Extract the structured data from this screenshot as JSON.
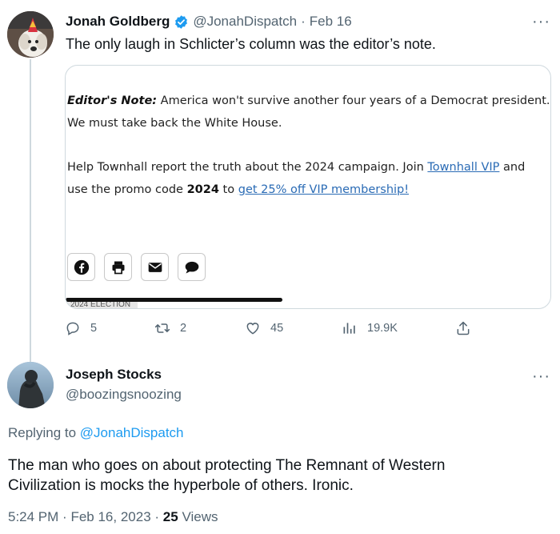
{
  "tweet1": {
    "author_name": "Jonah Goldberg",
    "handle": "@JonahDispatch",
    "separator": "·",
    "date": "Feb 16",
    "more": "···",
    "text": "The only laugh in Schlicter’s column was the editor’s note.",
    "card": {
      "note_label": "Editor's Note:",
      "note_line1": " America won't survive another four years of a Democrat president.",
      "note_line2": "We must take back the White House.",
      "help_pre": "Help Townhall report the truth about the 2024 campaign. Join ",
      "help_link1": "Townhall VIP",
      "help_mid": " and",
      "help_line2_pre": "use the promo code ",
      "promo_code": "2024",
      "help_line2_mid": " to ",
      "help_link2": "get 25% off VIP membership!",
      "tag": "2024 ELECTION",
      "share_icons": [
        "facebook-icon",
        "print-icon",
        "email-icon",
        "comment-icon"
      ]
    },
    "actions": {
      "replies": "5",
      "retweets": "2",
      "likes": "45",
      "views": "19.9K"
    }
  },
  "tweet2": {
    "author_name": "Joseph Stocks",
    "handle": "@boozingsnoozing",
    "more": "···",
    "replying_prefix": "Replying to ",
    "replying_to": "@JonahDispatch",
    "text_line1": "The man who goes on about protecting The Remnant of Western",
    "text_line2": "Civilization is mocks the hyperbole of others. Ironic.",
    "time": "5:24 PM",
    "date": "Feb 16, 2023",
    "separator": "·",
    "views_count": "25",
    "views_label": "Views"
  },
  "colors": {
    "primary_text": "#0f1419",
    "secondary_text": "#536471",
    "accent": "#1d9bf0",
    "card_link": "#2a6bb5",
    "border": "#cfd9de"
  }
}
